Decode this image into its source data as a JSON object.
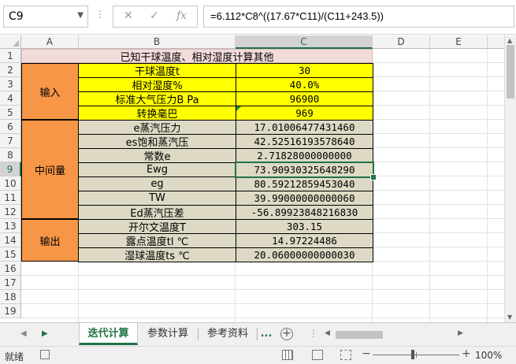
{
  "formula_bar": {
    "name_box": "C9",
    "formula": "=6.112*C8^((17.67*C11)/(C11+243.5))"
  },
  "columns": [
    "A",
    "B",
    "C",
    "D",
    "E"
  ],
  "rows": [
    "1",
    "2",
    "3",
    "4",
    "5",
    "6",
    "7",
    "8",
    "9",
    "10",
    "11",
    "12",
    "13",
    "14",
    "15",
    "16",
    "17",
    "18",
    "19"
  ],
  "sheet": {
    "title": "已知干球温度、相对湿度计算其他",
    "groups": {
      "input": "输入",
      "intermediate": "中间量",
      "output": "输出"
    },
    "items": [
      {
        "label": "干球温度t",
        "value": "30"
      },
      {
        "label": "相对湿度%",
        "value": "40.0%"
      },
      {
        "label": "标准大气压力B Pa",
        "value": "96900"
      },
      {
        "label": "转换毫巴",
        "value": "969"
      },
      {
        "label": "e蒸汽压力",
        "value": "17.01006477431460"
      },
      {
        "label": "es饱和蒸汽压",
        "value": "42.52516193578640"
      },
      {
        "label": "常数e",
        "value": "2.71828000000000"
      },
      {
        "label": "Ewg",
        "value": "73.90930325648290"
      },
      {
        "label": "eg",
        "value": "80.59212859453040"
      },
      {
        "label": "TW",
        "value": "39.99000000000060"
      },
      {
        "label": "Ed蒸汽压差",
        "value": "-56.89923848216830"
      },
      {
        "label": "开尔文温度T",
        "value": "303.15"
      },
      {
        "label": "露点温度tl ℃",
        "value": "14.97224486"
      },
      {
        "label": "湿球温度ts ℃",
        "value": "20.06000000000030"
      }
    ]
  },
  "tabs": {
    "items": [
      "迭代计算",
      "参数计算",
      "参考资料"
    ],
    "more": "...",
    "add": "+"
  },
  "status": {
    "ready": "就绪",
    "zoom_minus": "−",
    "zoom_plus": "+",
    "zoom": "100%"
  },
  "colors": {
    "accent": "#217346",
    "title_fill": "#f2dcdb",
    "input_fill": "#ffff00",
    "intermediate_fill": "#ddd9c4",
    "group_fill": "#f79646"
  }
}
